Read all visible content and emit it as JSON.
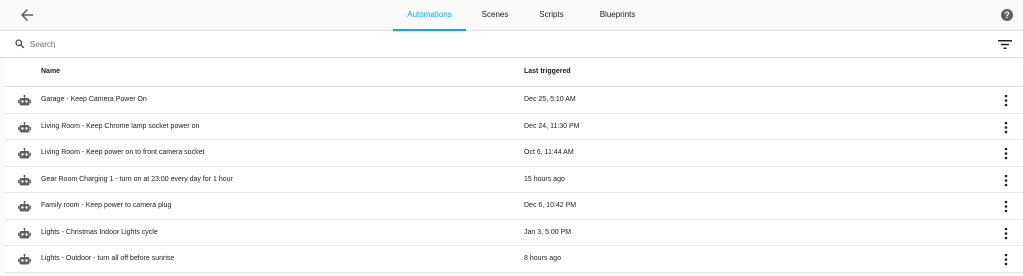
{
  "tabs": [
    {
      "label": "Automations",
      "active": true
    },
    {
      "label": "Scenes",
      "active": false
    },
    {
      "label": "Scripts",
      "active": false
    },
    {
      "label": "Blueprints",
      "active": false
    }
  ],
  "icons": {
    "back": "arrow-left-icon",
    "help": "help-circle-icon",
    "search": "magnify-icon",
    "filter": "filter-variant-icon",
    "row": "robot-icon",
    "menu": "dots-vertical-icon"
  },
  "search": {
    "placeholder": "Search",
    "value": ""
  },
  "table": {
    "columns": {
      "name": "Name",
      "last_triggered": "Last triggered"
    },
    "rows": [
      {
        "name": "Garage - Keep Camera Power On",
        "last_triggered": "Dec 25, 5:10 AM"
      },
      {
        "name": "Living Room - Keep Chrome lamp socket power on",
        "last_triggered": "Dec 24, 11:30 PM"
      },
      {
        "name": "Living Room - Keep power on to front camera socket",
        "last_triggered": "Oct 6, 11:44 AM"
      },
      {
        "name": "Gear Room Charging 1 - turn on at 23:00 every day for 1 hour",
        "last_triggered": "15 hours ago"
      },
      {
        "name": "Family room - Keep power to camera plug",
        "last_triggered": "Dec 6, 10:42 PM"
      },
      {
        "name": "Lights - Christmas Indoor Lights cycle",
        "last_triggered": "Jan 3, 5:00 PM"
      },
      {
        "name": "Lights - Outdoor - turn all off before sunrise",
        "last_triggered": "8 hours ago"
      }
    ]
  },
  "colors": {
    "accent": "#03a9f4",
    "icon": "#5f5f5f",
    "text": "#212121",
    "background": "#fafafa"
  }
}
